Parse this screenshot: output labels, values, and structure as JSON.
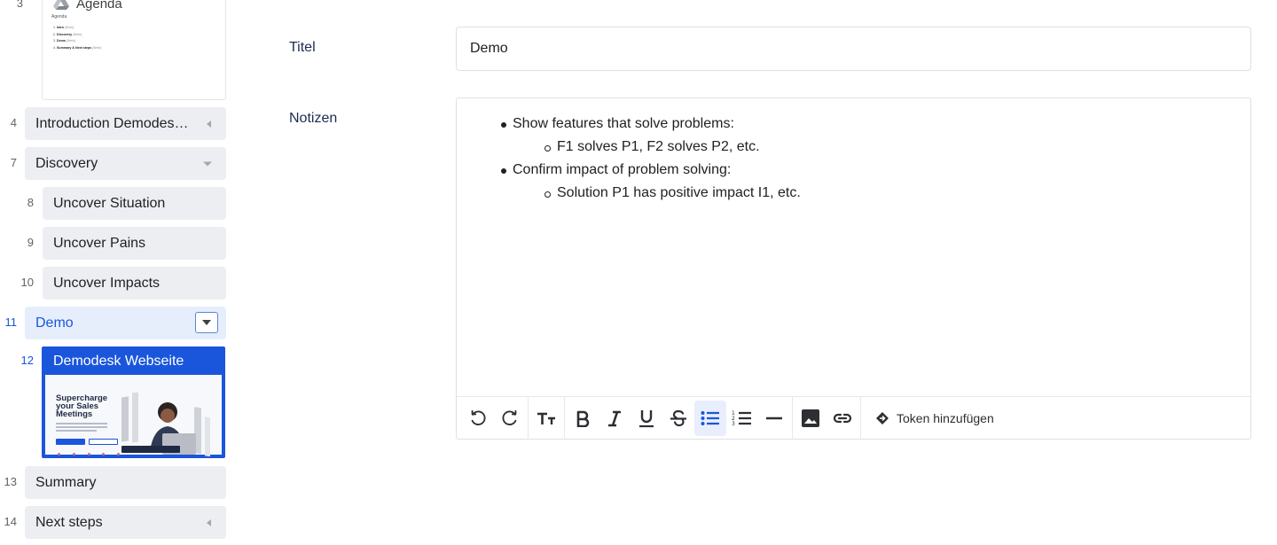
{
  "sidebar": {
    "agenda": {
      "number": "3",
      "title": "Agenda",
      "thumb_subtitle": "Agenda",
      "thumb_items": [
        {
          "n": "1.",
          "label": "Intro",
          "time": "(5min)"
        },
        {
          "n": "2.",
          "label": "Discovery",
          "time": "(5min)"
        },
        {
          "n": "3.",
          "label": "Demo",
          "time": "(5min)"
        },
        {
          "n": "4.",
          "label": "Summary & Next steps",
          "time": "(5min)"
        }
      ]
    },
    "items": [
      {
        "number": "4",
        "label": "Introduction Demodes…"
      },
      {
        "number": "7",
        "label": "Discovery"
      },
      {
        "number": "8",
        "label": "Uncover Situation"
      },
      {
        "number": "9",
        "label": "Uncover Pains"
      },
      {
        "number": "10",
        "label": "Uncover Impacts"
      },
      {
        "number": "11",
        "label": "Demo"
      },
      {
        "number": "12",
        "label": "Demodesk Webseite"
      },
      {
        "number": "13",
        "label": "Summary"
      },
      {
        "number": "14",
        "label": "Next steps"
      }
    ],
    "web_thumb": {
      "headline_1": "Supercharge",
      "headline_2": "your Sales",
      "headline_3": "Meetings"
    }
  },
  "form": {
    "title_label": "Titel",
    "title_value": "Demo",
    "notes_label": "Notizen",
    "notes": [
      {
        "text": "Show features that solve problems:",
        "children": [
          "F1 solves P1, F2 solves P2, etc."
        ]
      },
      {
        "text": "Confirm impact of problem solving:",
        "children": [
          "Solution P1 has positive impact I1, etc."
        ]
      }
    ]
  },
  "toolbar": {
    "token_label": "Token hinzufügen",
    "icons": [
      "undo-icon",
      "redo-icon",
      "font-size-icon",
      "bold-icon",
      "italic-icon",
      "underline-icon",
      "strikethrough-icon",
      "bullet-list-icon",
      "numbered-list-icon",
      "horizontal-rule-icon",
      "image-icon",
      "link-icon",
      "token-icon"
    ],
    "active": "bullet-list-icon"
  },
  "colors": {
    "accent": "#1a56db",
    "item_bg": "#eceef1",
    "label_color": "#1d2b4f"
  }
}
